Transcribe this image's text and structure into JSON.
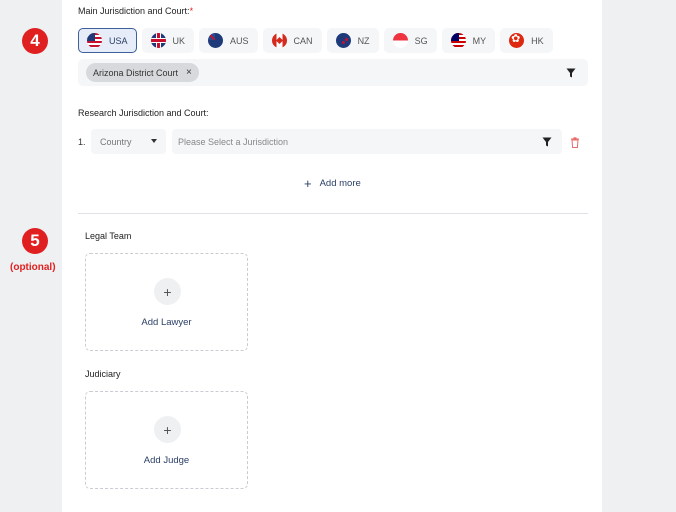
{
  "steps": {
    "step4": "4",
    "step5": "5",
    "optional": "(optional)"
  },
  "main_jurisdiction": {
    "label": "Main Jurisdiction and Court:",
    "required_mark": "*",
    "countries": [
      {
        "code": "USA",
        "flag": "flag-usa",
        "active": true
      },
      {
        "code": "UK",
        "flag": "flag-uk",
        "active": false
      },
      {
        "code": "AUS",
        "flag": "flag-aus",
        "active": false
      },
      {
        "code": "CAN",
        "flag": "flag-can",
        "active": false
      },
      {
        "code": "NZ",
        "flag": "flag-nz",
        "active": false
      },
      {
        "code": "SG",
        "flag": "flag-sg",
        "active": false
      },
      {
        "code": "MY",
        "flag": "flag-my",
        "active": false
      },
      {
        "code": "HK",
        "flag": "flag-hk",
        "active": false
      }
    ],
    "selected_court": "Arizona District Court",
    "chip_remove": "×",
    "filter_icon": "filter-icon"
  },
  "research_jurisdiction": {
    "label": "Research Jurisdiction and Court:",
    "row_number": "1.",
    "country_placeholder": "Country",
    "jurisdiction_placeholder": "Please Select a Jurisdiction",
    "add_more": "Add more",
    "add_more_icon": "+"
  },
  "legal_team": {
    "label": "Legal Team",
    "add_label": "Add Lawyer",
    "add_icon": "+"
  },
  "judiciary": {
    "label": "Judiciary",
    "add_label": "Add Judge",
    "add_icon": "+"
  },
  "colors": {
    "accent_red": "#e02020",
    "active_border": "#3d5f9a",
    "link_blue": "#2a3f66",
    "field_bg": "#f4f6f8"
  }
}
